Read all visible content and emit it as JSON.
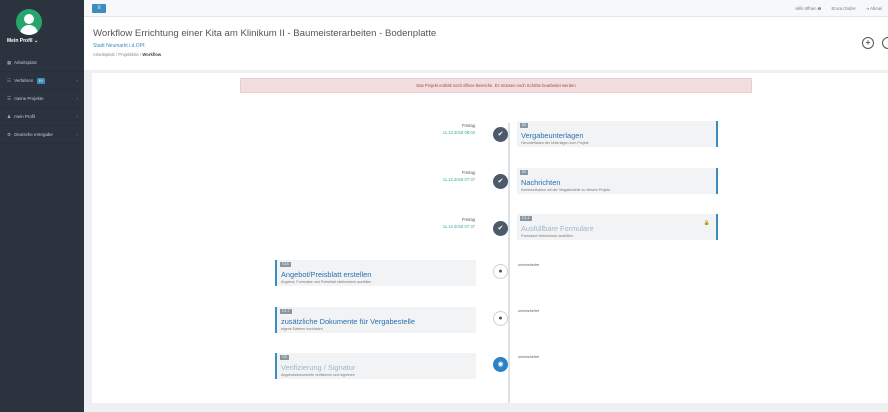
{
  "sidebar": {
    "profile_name": "Mein Profil ⌄",
    "items": [
      {
        "icon": "▦",
        "label": "Arbeitsplatz",
        "badge": "",
        "chevron": ""
      },
      {
        "icon": "☷",
        "label": "Verfahren",
        "badge": "19",
        "chevron": "‹"
      },
      {
        "icon": "☰",
        "label": "meine Projekte",
        "badge": "",
        "chevron": "‹"
      },
      {
        "icon": "♟",
        "label": "mein Profil",
        "badge": "",
        "chevron": "‹"
      },
      {
        "icon": "⚙",
        "label": "Deutsche eVergabe",
        "badge": "",
        "chevron": "‹"
      }
    ]
  },
  "topbar": {
    "menu_icon": "≡",
    "help": "Hilfe öffnen ❷",
    "company": "Emca GmbH",
    "logout": "⇥ Abmel"
  },
  "header": {
    "title": "Workflow Errichtung einer Kita am Klinikum II - Baumeisterarbeiten - Bodenplatte",
    "subtitle": "Stadt Neumarkt i.d.OPf.",
    "breadcrumb": {
      "a": "Arbeitsplatz",
      "sep": "/",
      "b": "Projektliste",
      "current": "Workflow"
    },
    "btn_add": "+"
  },
  "alert": "Das Projekt enthält noch offene Bereiche. Es müssen noch Schritte bearbeitet werden",
  "timeline_right": [
    {
      "code": "01",
      "title": "Vergabeunterlagen",
      "desc": "Herunterladen der Unterlagen zum Projekt",
      "day": "Freitag",
      "date": "11.12.2018 08:04",
      "icon": "✔",
      "dim": false,
      "lock": ""
    },
    {
      "code": "01",
      "title": "Nachrichten",
      "desc": "Kommunikation mit der Vergabestelle zu diesem Projekt",
      "day": "Freitag",
      "date": "11.12.2018 07:37",
      "icon": "✔",
      "dim": false,
      "lock": ""
    },
    {
      "code": "C1.1",
      "title": "Ausfüllbare Formulare",
      "desc": "Formulare elektronisch ausfüllen",
      "day": "Freitag",
      "date": "11.12.2018 07:37",
      "icon": "✔",
      "dim": true,
      "lock": "🔒"
    }
  ],
  "timeline_left": [
    {
      "code": "C14",
      "title": "Angebot/Preisblatt erstellen",
      "desc": "Angebot, Formulare und Preisblatt elektronisch ausfüllen",
      "status": "unbearbeitet",
      "icon": "●",
      "dim": false
    },
    {
      "code": "C1.7",
      "title": "zusätzliche Dokumente für Vergabestelle",
      "desc": "eigene Dateien hochladen",
      "status": "unbearbeitet",
      "icon": "●",
      "dim": false
    },
    {
      "code": "C5",
      "title": "Verifizierung / Signatur",
      "desc": "Angebotsdokumente verifizieren und signieren",
      "status": "unbearbeitet",
      "icon": "◉",
      "dim": true
    }
  ],
  "colors": {
    "accent": "#3c8dbc",
    "sidebar": "#2b333e",
    "alert_bg": "#f2dede",
    "green": "#27a56e"
  }
}
